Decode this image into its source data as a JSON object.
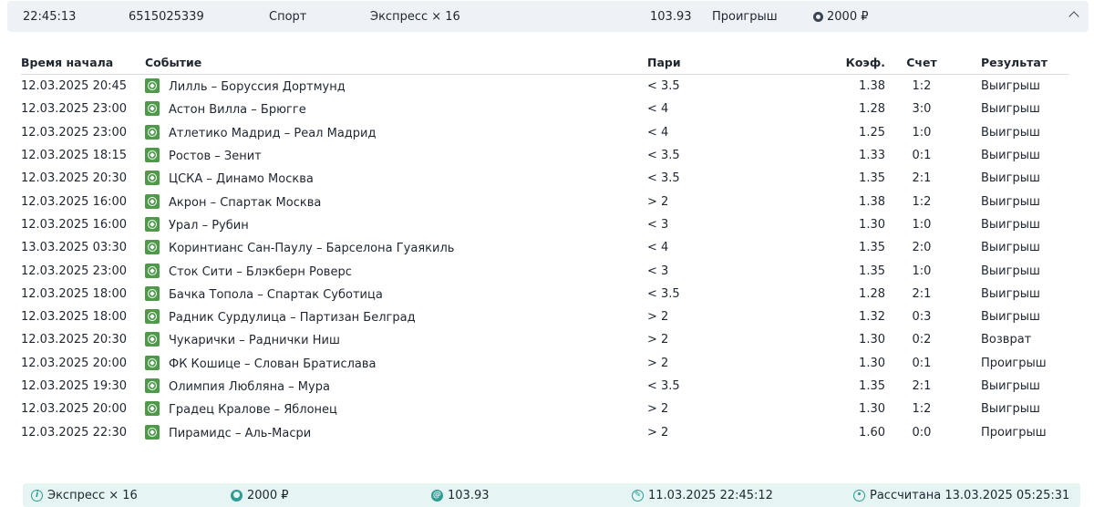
{
  "header": {
    "time": "22:45:13",
    "bet_id": "6515025339",
    "sport": "Спорт",
    "bet_type": "Экспресс × 16",
    "coefficient": "103.93",
    "status": "Проигрыш",
    "amount": "2000 ₽"
  },
  "table": {
    "columns": {
      "start_time": "Время начала",
      "event": "Событие",
      "pari": "Пари",
      "coef": "Коэф.",
      "score": "Счет",
      "result": "Результат"
    },
    "rows": [
      {
        "time": "12.03.2025 20:45",
        "event": "Лилль – Боруссия Дортмунд",
        "pari": "< 3.5",
        "coef": "1.38",
        "score": "1:2",
        "result": "Выигрыш"
      },
      {
        "time": "12.03.2025 23:00",
        "event": "Астон Вилла – Брюгге",
        "pari": "< 4",
        "coef": "1.28",
        "score": "3:0",
        "result": "Выигрыш"
      },
      {
        "time": "12.03.2025 23:00",
        "event": "Атлетико Мадрид – Реал Мадрид",
        "pari": "< 4",
        "coef": "1.25",
        "score": "1:0",
        "result": "Выигрыш"
      },
      {
        "time": "12.03.2025 18:15",
        "event": "Ростов – Зенит",
        "pari": "< 3.5",
        "coef": "1.33",
        "score": "0:1",
        "result": "Выигрыш"
      },
      {
        "time": "12.03.2025 20:30",
        "event": "ЦСКА – Динамо Москва",
        "pari": "< 3.5",
        "coef": "1.35",
        "score": "2:1",
        "result": "Выигрыш"
      },
      {
        "time": "12.03.2025 16:00",
        "event": "Акрон – Спартак Москва",
        "pari": "> 2",
        "coef": "1.38",
        "score": "1:2",
        "result": "Выигрыш"
      },
      {
        "time": "12.03.2025 16:00",
        "event": "Урал – Рубин",
        "pari": "< 3",
        "coef": "1.30",
        "score": "1:0",
        "result": "Выигрыш"
      },
      {
        "time": "13.03.2025 03:30",
        "event": "Коринтианс Сан-Паулу – Барселона Гуаякиль",
        "pari": "< 4",
        "coef": "1.35",
        "score": "2:0",
        "result": "Выигрыш"
      },
      {
        "time": "12.03.2025 23:00",
        "event": "Сток Сити – Блэкберн Роверс",
        "pari": "< 3",
        "coef": "1.35",
        "score": "1:0",
        "result": "Выигрыш"
      },
      {
        "time": "12.03.2025 18:00",
        "event": "Бачка Топола – Спартак Суботица",
        "pari": "< 3.5",
        "coef": "1.28",
        "score": "2:1",
        "result": "Выигрыш"
      },
      {
        "time": "12.03.2025 18:00",
        "event": "Радник Сурдулица – Партизан Белград",
        "pari": "> 2",
        "coef": "1.32",
        "score": "0:3",
        "result": "Выигрыш"
      },
      {
        "time": "12.03.2025 20:30",
        "event": "Чукарички – Раднички Ниш",
        "pari": "> 2",
        "coef": "1.30",
        "score": "0:2",
        "result": "Возврат"
      },
      {
        "time": "12.03.2025 20:00",
        "event": "ФК Кошице – Слован Братислава",
        "pari": "> 2",
        "coef": "1.30",
        "score": "0:1",
        "result": "Проигрыш"
      },
      {
        "time": "12.03.2025 19:30",
        "event": "Олимпия Любляна – Мура",
        "pari": "< 3.5",
        "coef": "1.35",
        "score": "2:1",
        "result": "Выигрыш"
      },
      {
        "time": "12.03.2025 20:00",
        "event": "Градец Кралове – Яблонец",
        "pari": "> 2",
        "coef": "1.30",
        "score": "1:2",
        "result": "Выигрыш"
      },
      {
        "time": "12.03.2025 22:30",
        "event": "Пирамидс – Аль-Масри",
        "pari": "> 2",
        "coef": "1.60",
        "score": "0:0",
        "result": "Проигрыш"
      }
    ]
  },
  "footer": {
    "bet_type": "Экспресс × 16",
    "amount": "2000 ₽",
    "coefficient": "103.93",
    "placed_at": "11.03.2025 22:45:12",
    "settled": "Рассчитана 13.03.2025 05:25:31"
  },
  "icons": {
    "sport": "football-icon",
    "accent_color": "#4e9a4a",
    "footer_accent": "#2f9c93"
  }
}
